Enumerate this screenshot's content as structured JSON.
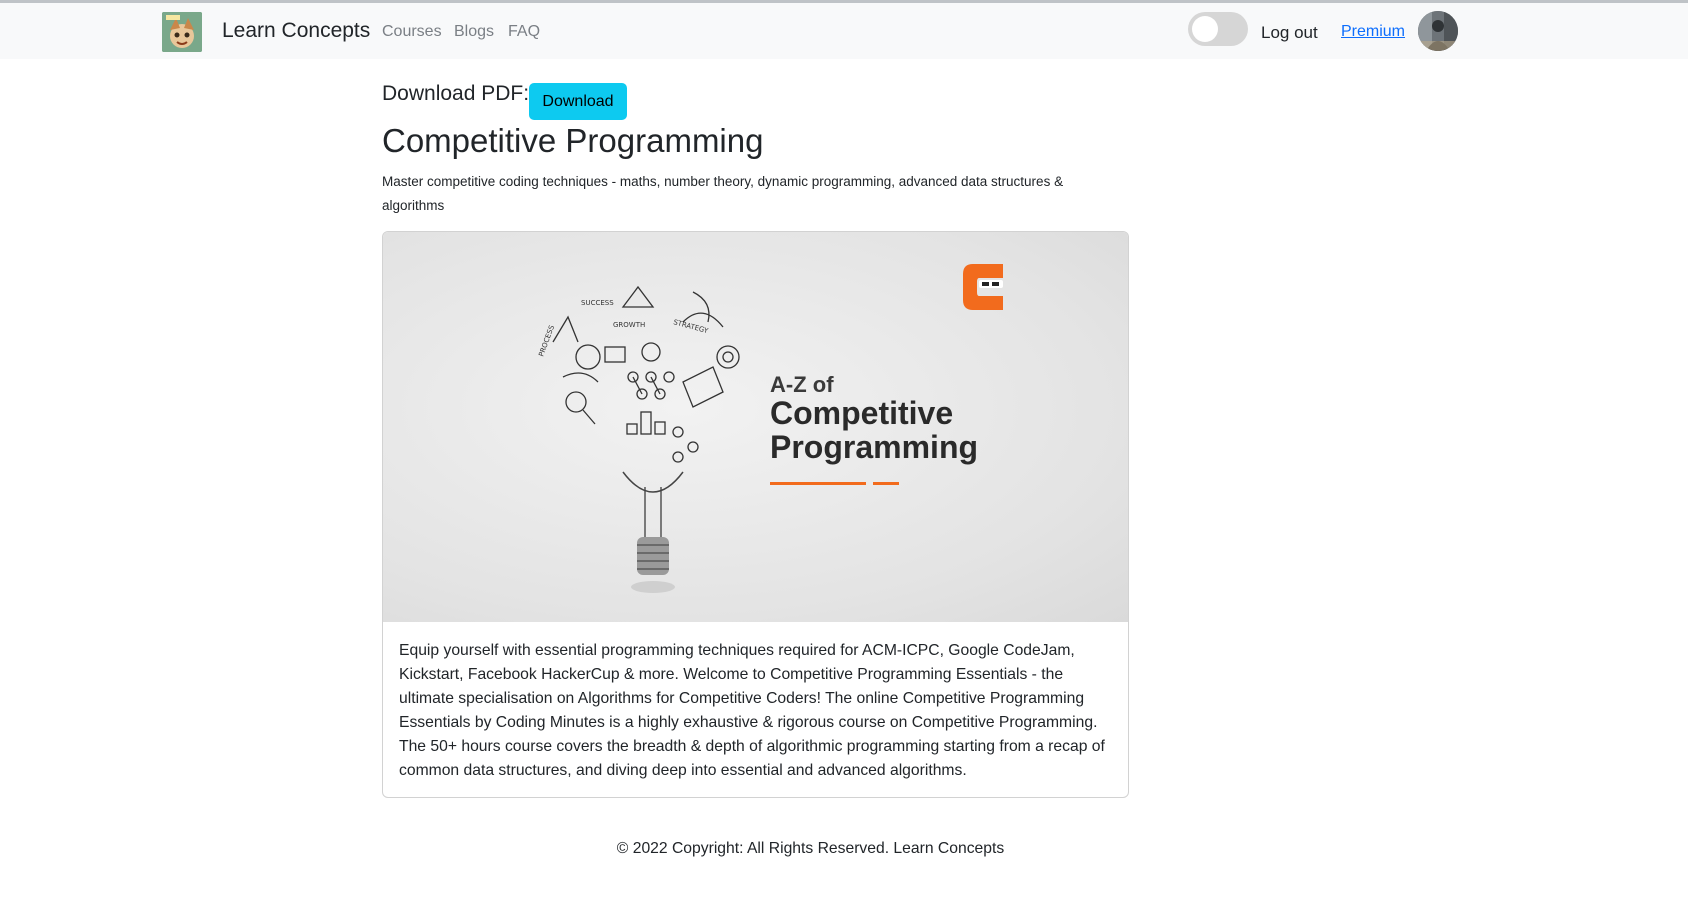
{
  "navbar": {
    "brand": "Learn Concepts",
    "links": [
      "Courses",
      "Blogs",
      "FAQ"
    ],
    "logout": "Log out",
    "premium": "Premium"
  },
  "download": {
    "label": "Download PDF:",
    "button": "Download"
  },
  "course": {
    "title": "Competitive Programming",
    "subtitle": "Master competitive coding techniques - maths, number theory, dynamic programming, advanced data structures & algorithms",
    "banner": {
      "line1": "A-Z of",
      "line2": "Competitive",
      "line3": "Programming",
      "doodle_words": [
        "SUCCESS",
        "GROWTH",
        "STRATEGY",
        "PROCESS"
      ]
    },
    "description": "Equip yourself with essential programming techniques required for ACM-ICPC, Google CodeJam, Kickstart, Facebook HackerCup & more. Welcome to Competitive Programming Essentials - the ultimate specialisation on Algorithms for Competitive Coders! The online Competitive Programming Essentials by Coding Minutes is a highly exhaustive & rigorous course on Competitive Programming. The 50+ hours course covers the breadth & depth of algorithmic programming starting from a recap of common data structures, and diving deep into essential and advanced algorithms."
  },
  "footer": {
    "text": "© 2022 Copyright: All Rights Reserved. Learn Concepts"
  },
  "colors": {
    "navbar_bg": "#f8f9fa",
    "download_button": "#0dcaf0",
    "link": "#0d6efd",
    "brand_orange": "#f26b1d"
  },
  "icons": [
    "brand-logo",
    "theme-toggle",
    "user-avatar",
    "coding-minutes-logo",
    "lightbulb-illustration"
  ]
}
